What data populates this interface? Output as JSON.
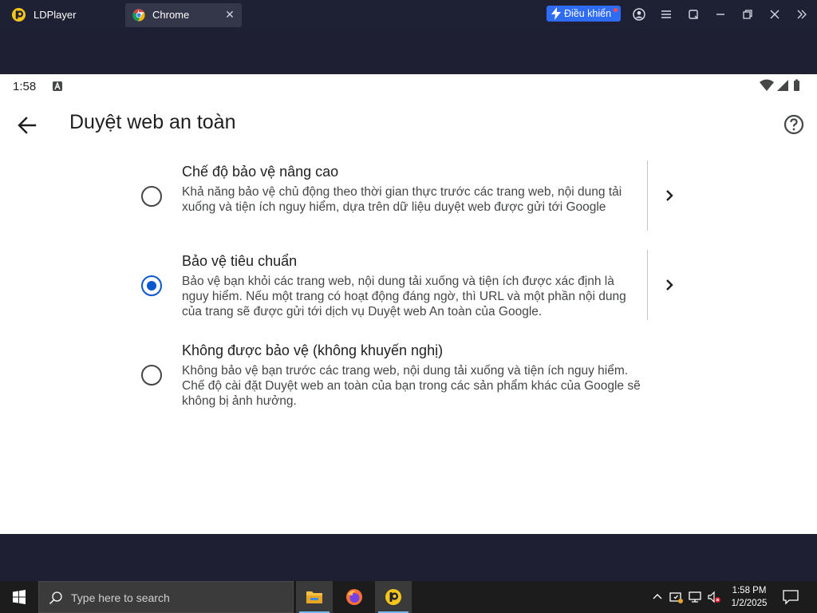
{
  "titlebar": {
    "app_name": "LDPlayer",
    "tab_title": "Chrome",
    "control_button": "Điều khiển"
  },
  "status_bar": {
    "time": "1:58"
  },
  "header": {
    "title": "Duyệt web an toàn"
  },
  "options": [
    {
      "title": "Chế độ bảo vệ nâng cao",
      "description": "Khả năng bảo vệ chủ động theo thời gian thực trước các trang web, nội dung tải xuống và tiện ích nguy hiểm, dựa trên dữ liệu duyệt web được gửi tới Google",
      "selected": false
    },
    {
      "title": "Bảo vệ tiêu chuẩn",
      "description": "Bảo vệ bạn khỏi các trang web, nội dung tải xuống và tiện ích được xác định là nguy hiểm. Nếu một trang có hoạt động đáng ngờ, thì URL và một phần nội dung của trang sẽ được gửi tới dịch vụ Duyệt web An toàn của Google.",
      "selected": true
    },
    {
      "title": "Không được bảo vệ (không khuyến nghị)",
      "description": "Không bảo vệ bạn trước các trang web, nội dung tải xuống và tiện ích nguy hiểm. Chế độ cài đặt Duyệt web an toàn của bạn trong các sản phẩm khác của Google sẽ không bị ảnh hưởng.",
      "selected": false
    }
  ],
  "taskbar": {
    "search_placeholder": "Type here to search",
    "time": "1:58 PM",
    "date": "1/2/2025"
  },
  "colors": {
    "accent": "#0b57d0",
    "control_button": "#2f6cf6",
    "frame": "#1e1f33"
  }
}
